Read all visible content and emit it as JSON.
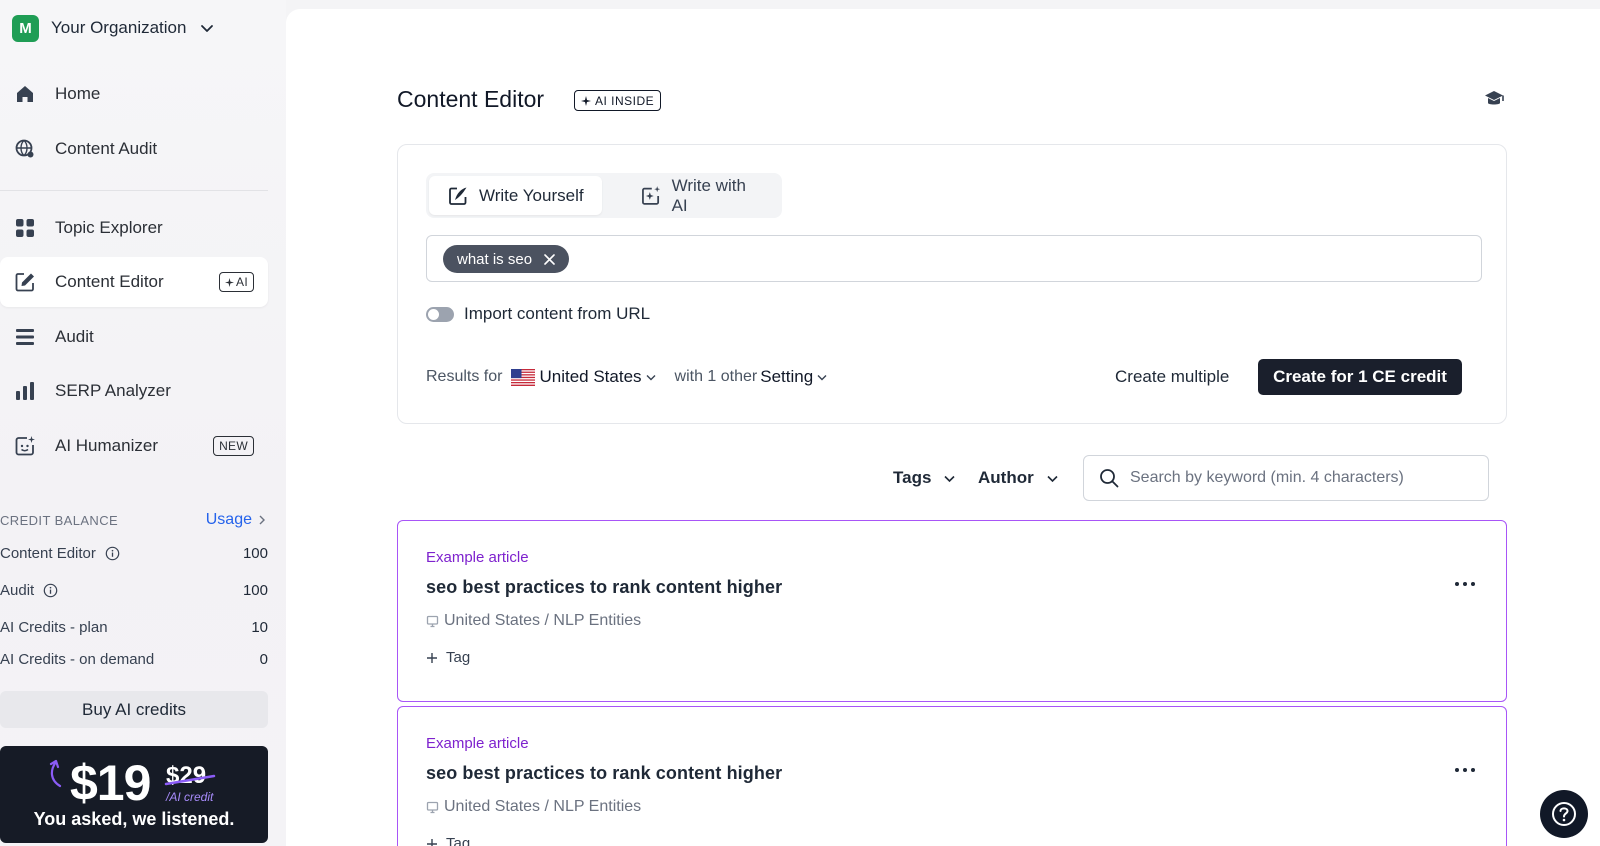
{
  "org": {
    "initial": "M",
    "name": "Your Organization"
  },
  "nav": {
    "home": "Home",
    "content_audit": "Content Audit",
    "topic_explorer": "Topic Explorer",
    "content_editor": "Content Editor",
    "content_editor_badge": "AI",
    "audit": "Audit",
    "serp_analyzer": "SERP Analyzer",
    "ai_humanizer": "AI Humanizer",
    "ai_humanizer_badge": "NEW"
  },
  "credits": {
    "title": "CREDIT BALANCE",
    "usage_label": "Usage",
    "rows": [
      {
        "label": "Content Editor",
        "value": "100"
      },
      {
        "label": "Audit",
        "value": "100"
      },
      {
        "label": "AI Credits - plan",
        "value": "10"
      },
      {
        "label": "AI Credits - on demand",
        "value": "0"
      }
    ],
    "buy_label": "Buy AI credits"
  },
  "promo": {
    "price": "$19",
    "old_price": "$29",
    "unit": "/AI credit",
    "tagline": "You asked, we listened."
  },
  "page": {
    "title": "Content Editor",
    "badge": "AI INSIDE"
  },
  "create": {
    "tab_write_yourself": "Write Yourself",
    "tab_write_ai": "Write with AI",
    "keyword_chip": "what is seo",
    "import_label": "Import content from URL",
    "results_for": "Results for",
    "country": "United States",
    "with_other": "with 1 other",
    "setting": "Setting",
    "create_multiple": "Create multiple",
    "create_button": "Create for 1 CE credit"
  },
  "filters": {
    "tags": "Tags",
    "author": "Author",
    "search_placeholder": "Search by keyword (min. 4 characters)"
  },
  "articles": [
    {
      "kind": "Example article",
      "title": "seo best practices to rank content higher",
      "meta": "United States / NLP Entities",
      "tag_label": "Tag"
    },
    {
      "kind": "Example article",
      "title": "seo best practices to rank content higher",
      "meta": "United States / NLP Entities",
      "tag_label": "Tag"
    }
  ],
  "colors": {
    "accent_purple": "#a855f7",
    "primary_dark": "#1a1f2c",
    "link_blue": "#2563eb",
    "org_green": "#1f9d55"
  }
}
